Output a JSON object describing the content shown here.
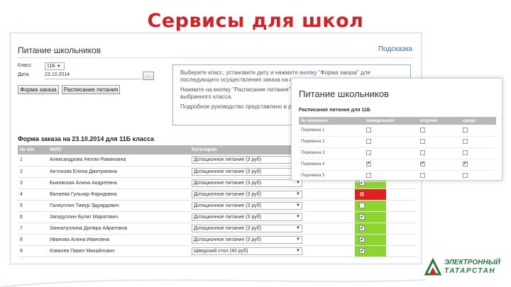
{
  "slide": {
    "title": "Сервисы для школ"
  },
  "app": {
    "page_title": "Питание школьников",
    "help_link": "Подсказка"
  },
  "filters": {
    "class_label": "Класс",
    "class_value": "11Б",
    "date_label": "Дата",
    "date_value": "23.10.2014",
    "date_button": "..."
  },
  "buttons": {
    "order_form": "Форма заказа",
    "schedule": "Расписание питания"
  },
  "info": {
    "p1": "Выберите класс, установите дату и нажмите кнопку \"Форма заказа\" для последующего осуществления заказа на питание.",
    "p2": "Нажмите на кнопку \"Расписание питания\" для просмотра расписания питания выбранного класса.",
    "p3": "Подробное руководство представлено в разделе"
  },
  "order": {
    "heading": "Форма заказа на 23.10.2014 для 11Б класса",
    "columns": [
      "№ п/п",
      "ФИО",
      "Категория",
      "",
      ""
    ],
    "rows": [
      {
        "num": "1",
        "name": "Александрова Нелли Романовна",
        "category": "Дотационное питание (3 руб)",
        "status": "green",
        "checked": true
      },
      {
        "num": "2",
        "name": "Антонова Елена Дмитриевна",
        "category": "Дотационное питание (3 руб)",
        "status": "green",
        "checked": true
      },
      {
        "num": "3",
        "name": "Быковская Алина Андреевна",
        "category": "Дотационное питание (3 руб)",
        "status": "green",
        "checked": true
      },
      {
        "num": "4",
        "name": "Валиева Гульнар Фаридовна",
        "category": "Дотационное питание (3 руб)",
        "status": "red",
        "checked": false
      },
      {
        "num": "5",
        "name": "Галиуллин Тимур Эдуардович",
        "category": "Дотационное питание (3 руб)",
        "status": "green",
        "checked": false
      },
      {
        "num": "6",
        "name": "Загидуллин Булат Маратович",
        "category": "Дотационное питание (3 руб)",
        "status": "green",
        "checked": true
      },
      {
        "num": "7",
        "name": "Зиннатуллина Диляра Айратовна",
        "category": "Дотационное питание (3 руб)",
        "status": "green",
        "checked": true
      },
      {
        "num": "8",
        "name": "Иванова Алина Ивановна",
        "category": "Дотационное питание (3 руб)",
        "status": "green",
        "checked": true
      },
      {
        "num": "9",
        "name": "Ковалев Павел Михайлович",
        "category": "Шведский стол (40 руб)",
        "status": "green",
        "checked": true
      }
    ]
  },
  "popup": {
    "title": "Питание школьников",
    "subtitle": "Расписание питания для 11Б",
    "columns": [
      "№ перемены",
      "понедельник",
      "вторник",
      "среда"
    ],
    "rows": [
      {
        "label": "Перемена 1",
        "checks": [
          false,
          false,
          false
        ]
      },
      {
        "label": "Перемена 2",
        "checks": [
          false,
          false,
          false
        ]
      },
      {
        "label": "Перемена 3",
        "checks": [
          false,
          false,
          false
        ]
      },
      {
        "label": "Перемена 4",
        "checks": [
          true,
          true,
          true
        ]
      },
      {
        "label": "Перемена 5",
        "checks": [
          false,
          false,
          false
        ]
      }
    ]
  },
  "logo": {
    "line1": "ЭЛЕКТРОННЫЙ",
    "line2": "ТАТАРСТАН"
  },
  "colors": {
    "title_red": "#d0242b",
    "status_green": "#8dd42e",
    "status_red": "#e02020",
    "link_blue": "#2a6db0",
    "logo_green": "#2a7a3a"
  }
}
